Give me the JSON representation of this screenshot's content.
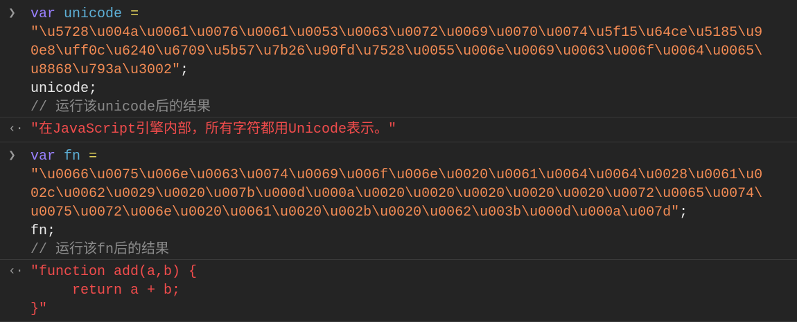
{
  "entries": [
    {
      "keyword": "var",
      "identifier": "unicode",
      "operator": "=",
      "string_lines": [
        "\"\\u5728\\u004a\\u0061\\u0076\\u0061\\u0053\\u0063\\u0072\\u0069\\u0070\\u0074\\u5f15\\u64ce\\u5185\\u9",
        "0e8\\uff0c\\u6240\\u6709\\u5b57\\u7b26\\u90fd\\u7528\\u0055\\u006e\\u0069\\u0063\\u006f\\u0064\\u0065\\",
        "u8868\\u793a\\u3002\""
      ],
      "terminator": ";",
      "expression": "unicode;",
      "comment": "// 运行该unicode后的结果",
      "result_lines": [
        "\"在JavaScript引擎内部，所有字符都用Unicode表示。\""
      ]
    },
    {
      "keyword": "var",
      "identifier": "fn",
      "operator": "=",
      "string_lines": [
        "\"\\u0066\\u0075\\u006e\\u0063\\u0074\\u0069\\u006f\\u006e\\u0020\\u0061\\u0064\\u0064\\u0028\\u0061\\u0",
        "02c\\u0062\\u0029\\u0020\\u007b\\u000d\\u000a\\u0020\\u0020\\u0020\\u0020\\u0020\\u0072\\u0065\\u0074\\",
        "u0075\\u0072\\u006e\\u0020\\u0061\\u0020\\u002b\\u0020\\u0062\\u003b\\u000d\\u000a\\u007d\""
      ],
      "terminator": ";",
      "expression": "fn;",
      "comment": "// 运行该fn后的结果",
      "result_lines": [
        "\"function add(a,b) {",
        "     return a + b;",
        "}\""
      ]
    }
  ],
  "icons": {
    "input_prompt": "chevron-right-icon",
    "result_prompt": "return-arrow-icon"
  },
  "colors": {
    "background": "#242424",
    "string": "#f28b54",
    "keyword": "#9980ff",
    "identifier": "#5db0d7",
    "result": "#f14c4c",
    "comment": "#8a8a8a"
  }
}
